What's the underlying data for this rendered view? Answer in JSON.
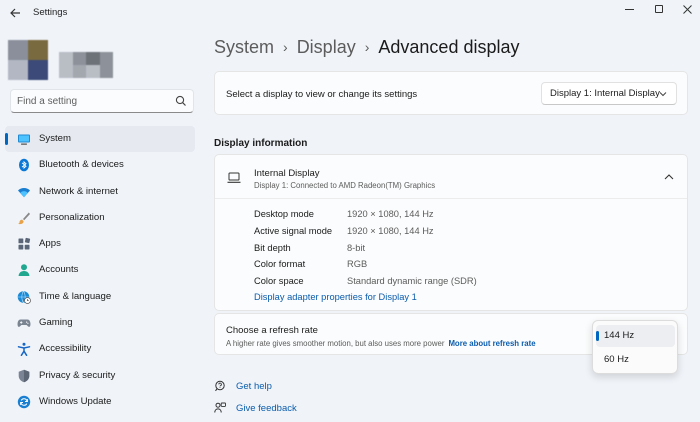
{
  "window": {
    "title": "Settings"
  },
  "search": {
    "placeholder": "Find a setting"
  },
  "sidebar": {
    "items": [
      {
        "label": "System",
        "icon": "monitor-icon",
        "active": true
      },
      {
        "label": "Bluetooth & devices",
        "icon": "bluetooth-icon"
      },
      {
        "label": "Network & internet",
        "icon": "wifi-icon"
      },
      {
        "label": "Personalization",
        "icon": "paintbrush-icon"
      },
      {
        "label": "Apps",
        "icon": "apps-icon"
      },
      {
        "label": "Accounts",
        "icon": "person-icon"
      },
      {
        "label": "Time & language",
        "icon": "globe-clock-icon"
      },
      {
        "label": "Gaming",
        "icon": "gamepad-icon"
      },
      {
        "label": "Accessibility",
        "icon": "accessibility-icon"
      },
      {
        "label": "Privacy & security",
        "icon": "shield-icon"
      },
      {
        "label": "Windows Update",
        "icon": "update-icon"
      }
    ]
  },
  "breadcrumb": {
    "items": [
      "System",
      "Display"
    ],
    "current": "Advanced display"
  },
  "display_select": {
    "label": "Select a display to view or change its settings",
    "value": "Display 1: Internal Display"
  },
  "display_info": {
    "section_title": "Display information",
    "name": "Internal Display",
    "subtitle": "Display 1: Connected to AMD Radeon(TM) Graphics",
    "rows": [
      {
        "key": "Desktop mode",
        "value": "1920 × 1080, 144 Hz"
      },
      {
        "key": "Active signal mode",
        "value": "1920 × 1080, 144 Hz"
      },
      {
        "key": "Bit depth",
        "value": "8-bit"
      },
      {
        "key": "Color format",
        "value": "RGB"
      },
      {
        "key": "Color space",
        "value": "Standard dynamic range (SDR)"
      }
    ],
    "adapter_link": "Display adapter properties for Display 1"
  },
  "refresh_rate": {
    "title": "Choose a refresh rate",
    "description": "A higher rate gives smoother motion, but also uses more power",
    "more_link": "More about refresh rate",
    "options": [
      "144 Hz",
      "60 Hz"
    ],
    "selected": "144 Hz"
  },
  "help": {
    "get_help": "Get help",
    "give_feedback": "Give feedback"
  },
  "colors": {
    "accent": "#0067c0",
    "link": "#0b5cad",
    "background": "#f0f4f9",
    "card": "#fbfcfd"
  }
}
